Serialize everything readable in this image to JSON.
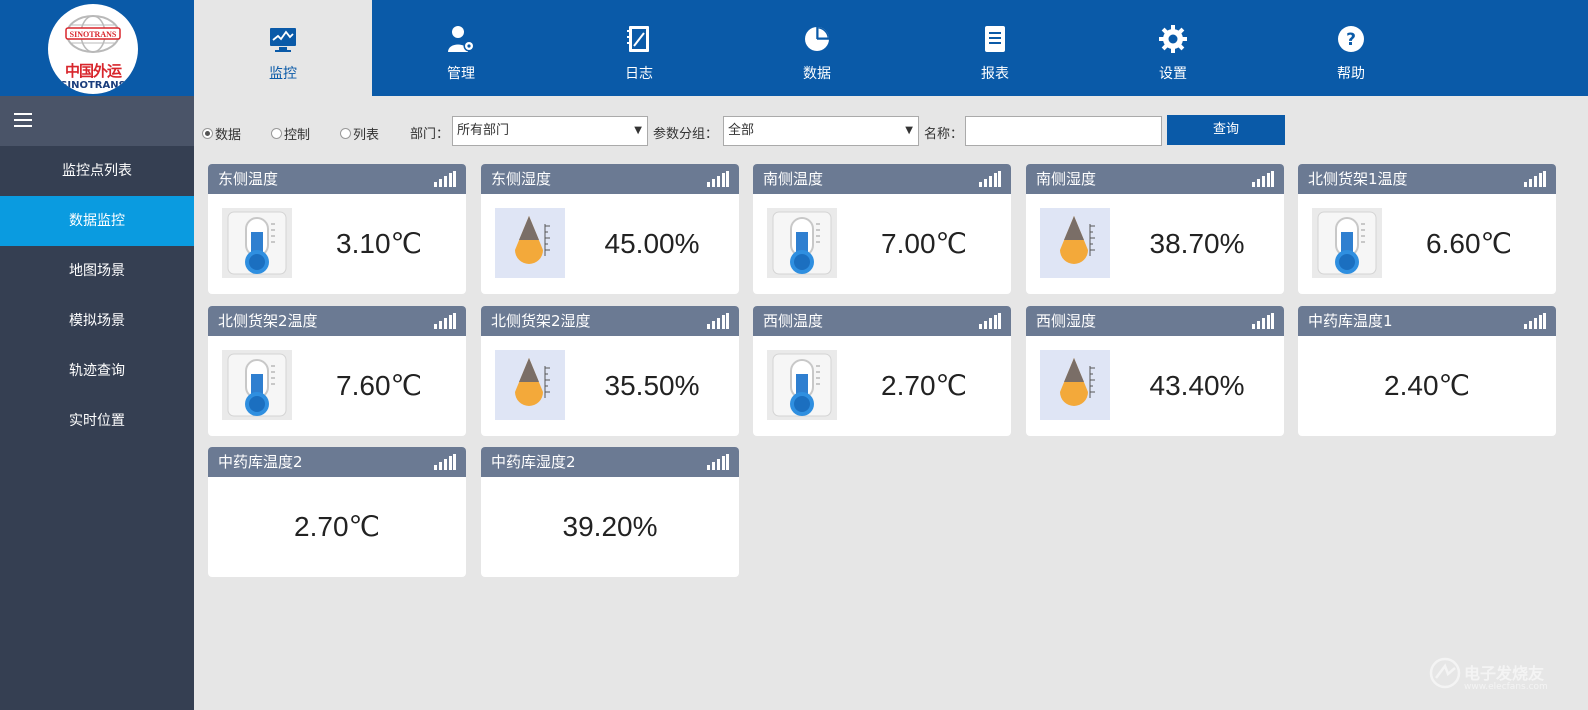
{
  "logo": {
    "cn_text": "中国外运",
    "en_text": "SINOTRANS",
    "en_text2": "SINOTRANS"
  },
  "nav": [
    {
      "label": "监控",
      "icon": "monitor-icon",
      "active": true
    },
    {
      "label": "管理",
      "icon": "user-gear-icon",
      "active": false
    },
    {
      "label": "日志",
      "icon": "notebook-icon",
      "active": false
    },
    {
      "label": "数据",
      "icon": "pie-chart-icon",
      "active": false
    },
    {
      "label": "报表",
      "icon": "document-icon",
      "active": false
    },
    {
      "label": "设置",
      "icon": "gear-icon",
      "active": false
    },
    {
      "label": "帮助",
      "icon": "help-icon",
      "active": false
    }
  ],
  "sidebar": {
    "items": [
      {
        "label": "监控点列表",
        "active": false
      },
      {
        "label": "数据监控",
        "active": true
      },
      {
        "label": "地图场景",
        "active": false
      },
      {
        "label": "模拟场景",
        "active": false
      },
      {
        "label": "轨迹查询",
        "active": false
      },
      {
        "label": "实时位置",
        "active": false
      }
    ]
  },
  "filter": {
    "radios": [
      {
        "label": "数据",
        "checked": true
      },
      {
        "label": "控制",
        "checked": false
      },
      {
        "label": "列表",
        "checked": false
      }
    ],
    "dept_label": "部门：",
    "dept_value": "所有部门",
    "group_label": "参数分组：",
    "group_value": "全部",
    "name_label": "名称：",
    "name_value": "",
    "query_label": "查询"
  },
  "cards": [
    {
      "title": "东侧温度",
      "value": "3.10℃",
      "type": "temp"
    },
    {
      "title": "东侧湿度",
      "value": "45.00%",
      "type": "humid"
    },
    {
      "title": "南侧温度",
      "value": "7.00℃",
      "type": "temp"
    },
    {
      "title": "南侧湿度",
      "value": "38.70%",
      "type": "humid"
    },
    {
      "title": "北侧货架1温度",
      "value": "6.60℃",
      "type": "temp"
    },
    {
      "title": "北侧货架2温度",
      "value": "7.60℃",
      "type": "temp"
    },
    {
      "title": "北侧货架2湿度",
      "value": "35.50%",
      "type": "humid"
    },
    {
      "title": "西侧温度",
      "value": "2.70℃",
      "type": "temp"
    },
    {
      "title": "西侧湿度",
      "value": "43.40%",
      "type": "humid"
    },
    {
      "title": "中药库温度1",
      "value": "2.40℃",
      "type": "none"
    },
    {
      "title": "中药库温度2",
      "value": "2.70℃",
      "type": "none"
    },
    {
      "title": "中药库湿度2",
      "value": "39.20%",
      "type": "none"
    }
  ],
  "watermark": {
    "text": "电子发烧友",
    "url": "www.elecfans.com"
  },
  "colors": {
    "brand": "#0a5aa8",
    "sidebar": "#353f52",
    "sidebar_active": "#0a9be0",
    "card_header": "#6b7a93"
  }
}
